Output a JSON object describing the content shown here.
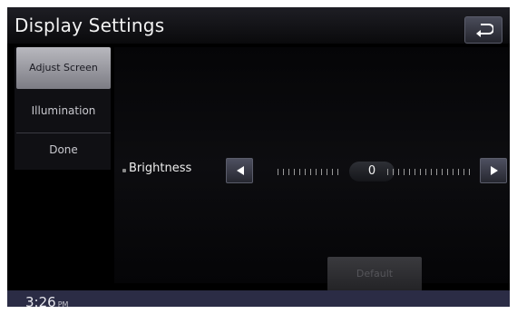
{
  "header": {
    "title": "Display Settings",
    "back_icon": "back-arrow-icon"
  },
  "sidebar": {
    "items": [
      {
        "label": "Adjust Screen",
        "selected": true
      },
      {
        "label": "Illumination",
        "selected": false
      },
      {
        "label": "Done",
        "selected": false
      }
    ]
  },
  "brightness": {
    "label": "Brightness",
    "value": "0",
    "decrease_icon": "triangle-left-icon",
    "increase_icon": "triangle-right-icon"
  },
  "default_button": {
    "label": "Default",
    "enabled": false
  },
  "status": {
    "time": "3:26",
    "ampm": "PM"
  },
  "colors": {
    "background": "#000000",
    "selected_item": "#a5a5ab",
    "status_bar": "#2b2c45"
  }
}
